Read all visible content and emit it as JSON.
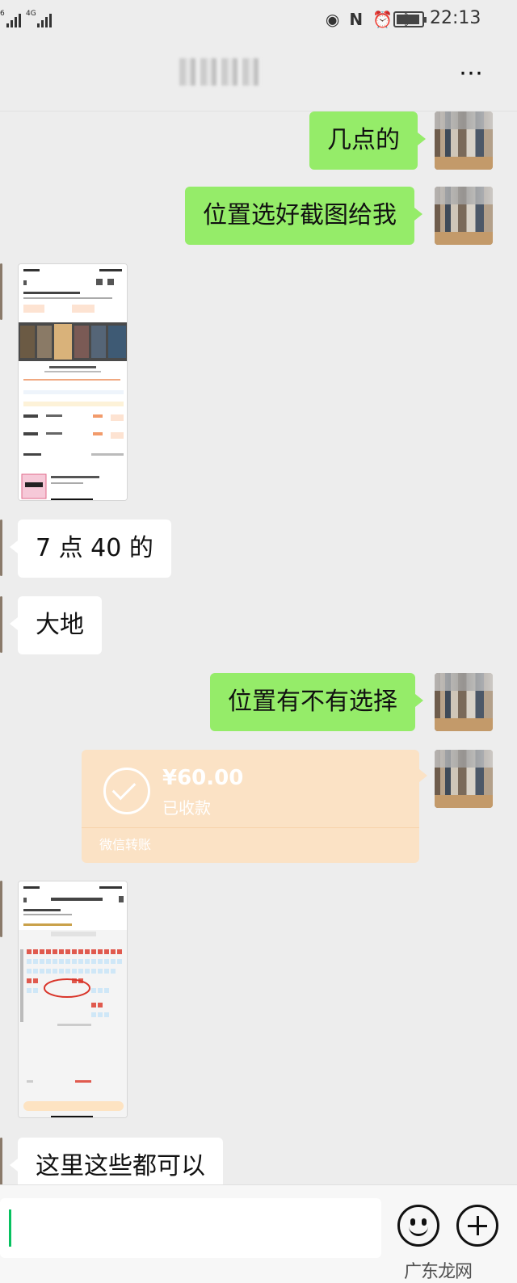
{
  "status_bar": {
    "sim1": "6",
    "sim2": "4G",
    "time": "22:13"
  },
  "header": {
    "more_icon": "⋯"
  },
  "messages": [
    {
      "side": "me",
      "type": "text",
      "text": "几点的"
    },
    {
      "side": "me",
      "type": "text",
      "text": "位置选好截图给我"
    },
    {
      "side": "other",
      "type": "image",
      "content": "cinema-showtimes-screenshot"
    },
    {
      "side": "other",
      "type": "text",
      "text": "7 点 40 的"
    },
    {
      "side": "other",
      "type": "text",
      "text": "大地"
    },
    {
      "side": "me",
      "type": "text",
      "text": "位置有不有选择"
    },
    {
      "side": "me",
      "type": "transfer",
      "amount": "¥60.00",
      "status": "已收款",
      "source": "微信转账"
    },
    {
      "side": "other",
      "type": "image",
      "content": "seat-map-screenshot"
    },
    {
      "side": "other",
      "type": "text",
      "text": "这里这些都可以"
    }
  ],
  "input_bar": {
    "value": "",
    "emoji_icon": "emoji-icon",
    "plus_icon": "plus-icon"
  },
  "watermark": "广东龙网"
}
